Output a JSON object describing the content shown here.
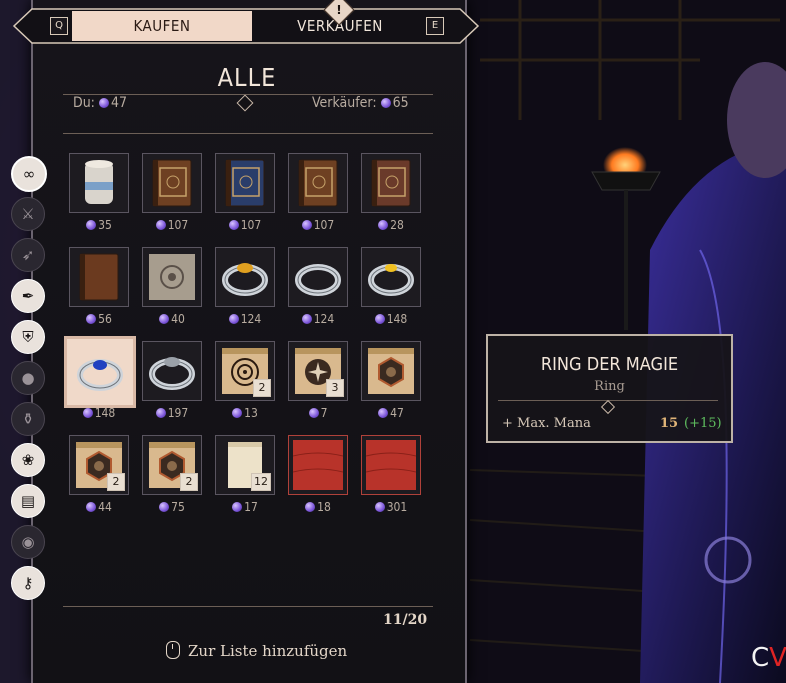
{
  "tabs": {
    "left_key": "Q",
    "buy": "KAUFEN",
    "sell": "VERKAUFEN",
    "right_key": "E",
    "alert": "!"
  },
  "header": {
    "title": "ALLE",
    "player_label": "Du:",
    "player_gold": "47",
    "merchant_label": "Verkäufer:",
    "merchant_gold": "65"
  },
  "categories": [
    {
      "icon": "infinity-icon",
      "glyph": "∞",
      "state": "active"
    },
    {
      "icon": "crossed-swords-icon",
      "glyph": "⚔",
      "state": "dim"
    },
    {
      "icon": "bow-icon",
      "glyph": "➶",
      "state": "dim"
    },
    {
      "icon": "feather-icon",
      "glyph": "✒",
      "state": "bright"
    },
    {
      "icon": "armor-icon",
      "glyph": "⛨",
      "state": "bright"
    },
    {
      "icon": "apple-icon",
      "glyph": "●",
      "state": "dim"
    },
    {
      "icon": "potion-icon",
      "glyph": "⚱",
      "state": "dim"
    },
    {
      "icon": "herb-icon",
      "glyph": "❀",
      "state": "bright"
    },
    {
      "icon": "book-icon",
      "glyph": "▤",
      "state": "bright"
    },
    {
      "icon": "pouch-icon",
      "glyph": "◉",
      "state": "dim"
    },
    {
      "icon": "key-icon",
      "glyph": "⚷",
      "state": "bright"
    }
  ],
  "items": [
    {
      "kind": "jar",
      "price": "35"
    },
    {
      "kind": "book-brown",
      "price": "107"
    },
    {
      "kind": "book-blue",
      "price": "107"
    },
    {
      "kind": "book-brown",
      "price": "107"
    },
    {
      "kind": "book-red",
      "price": "28"
    },
    {
      "kind": "book-plain",
      "price": "56"
    },
    {
      "kind": "map-stone",
      "price": "40"
    },
    {
      "kind": "ring-gold-gem",
      "price": "124"
    },
    {
      "kind": "ring-plain",
      "price": "124"
    },
    {
      "kind": "ring-yellow-gem",
      "price": "148"
    },
    {
      "kind": "ring-blue-gem",
      "price": "148",
      "selected": true
    },
    {
      "kind": "ring-signet",
      "price": "197"
    },
    {
      "kind": "scroll-target",
      "price": "13",
      "count": "2"
    },
    {
      "kind": "scroll-star",
      "price": "7",
      "count": "3"
    },
    {
      "kind": "scroll-hex",
      "price": "47"
    },
    {
      "kind": "scroll-hex-dark",
      "price": "44",
      "count": "2"
    },
    {
      "kind": "scroll-hex-bee",
      "price": "75",
      "count": "2"
    },
    {
      "kind": "paper",
      "price": "17",
      "count": "12"
    },
    {
      "kind": "cloth-red",
      "price": "18",
      "red": true
    },
    {
      "kind": "cloth-red",
      "price": "301",
      "red": true
    }
  ],
  "footer": {
    "pager": "11/20",
    "hint": "Zur Liste hinzufügen"
  },
  "tooltip": {
    "name": "RING DER MAGIE",
    "type": "Ring",
    "stat_label": "+ Max. Mana",
    "stat_value": "15",
    "stat_bonus": "(+15)"
  },
  "watermark": {
    "c": "C",
    "v": "V"
  },
  "colors": {
    "accent": "#f1d8c8",
    "coin": "#7a54d8",
    "bonus": "#5fbf5f",
    "stat_value": "#e0b478",
    "warning_border": "#b0413a"
  }
}
